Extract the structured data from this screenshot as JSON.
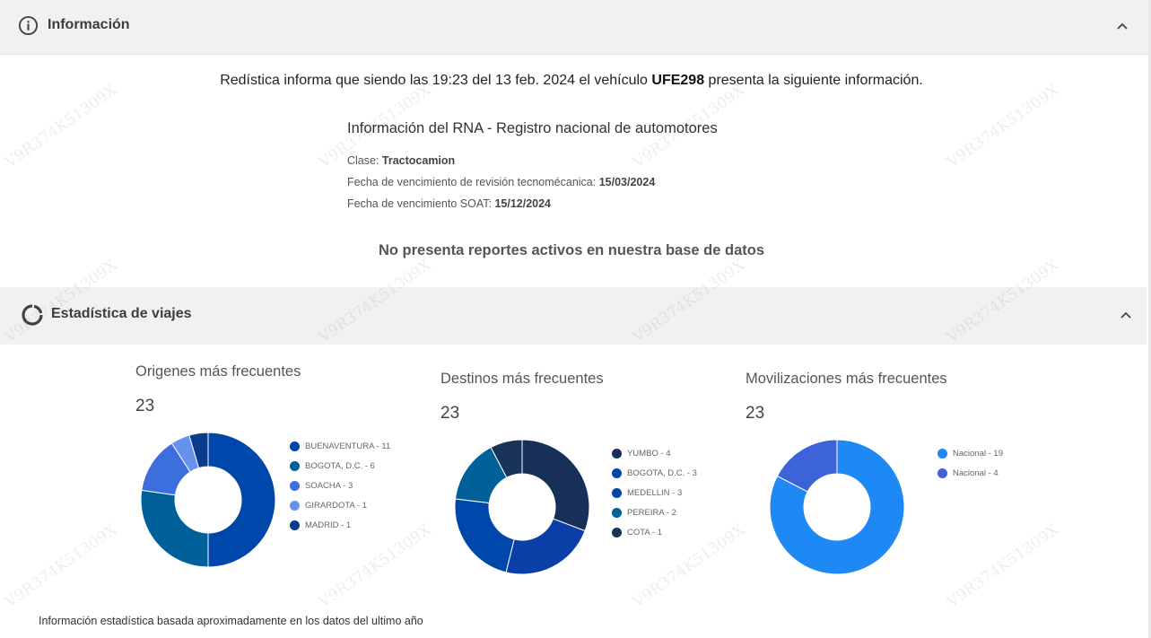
{
  "info": {
    "title": "Información",
    "intro_pre": "Redística informa que siendo las 19:23 del 13 feb. 2024 el vehículo ",
    "plate": "UFE298",
    "intro_post": " presenta la siguiente información.",
    "rna_title": "Información del RNA - Registro nacional de automotores",
    "clase_label": "Clase: ",
    "clase_value": "Tractocamion",
    "tecno_label": "Fecha de vencimiento de revisión tecnomécanica: ",
    "tecno_value": "15/03/2024",
    "soat_label": "Fecha de vencimiento SOAT: ",
    "soat_value": "15/12/2024",
    "no_reports": "No presenta reportes activos en nuestra base de datos"
  },
  "stats": {
    "title": "Estadística de viajes",
    "footer": "Información estadística basada aproximadamente en los datos del ultimo año"
  },
  "watermark_text": "V9R374K51309X",
  "icons": {
    "info": "info-circle-icon",
    "stats": "donut-chart-icon",
    "collapse": "chevron-up-icon"
  },
  "chart_data": [
    {
      "type": "pie",
      "title": "Origenes más frecuentes",
      "total": "23",
      "categories": [
        "BUENAVENTURA - 11",
        "BOGOTA, D.C. - 6",
        "SOACHA - 3",
        "GIRARDOTA - 1",
        "MADRID - 1"
      ],
      "values": [
        11,
        6,
        3,
        1,
        1
      ],
      "colors": [
        "#0047ab",
        "#00609a",
        "#3d6ede",
        "#6692ee",
        "#0b3b8c"
      ],
      "legend": "right"
    },
    {
      "type": "pie",
      "title": "Destinos más frecuentes",
      "total": "23",
      "categories": [
        "YUMBO - 4",
        "BOGOTA, D.C. - 3",
        "MEDELLIN - 3",
        "PEREIRA - 2",
        "COTA - 1"
      ],
      "values": [
        4,
        3,
        3,
        2,
        1
      ],
      "colors": [
        "#17305a",
        "#0a3fa8",
        "#0047ab",
        "#00609a",
        "#1a3358"
      ],
      "legend": "right"
    },
    {
      "type": "pie",
      "title": "Movilizaciones más frecuentes",
      "total": "23",
      "categories": [
        "Nacional - 19",
        "Nacional - 4"
      ],
      "values": [
        19,
        4
      ],
      "colors": [
        "#1e88f5",
        "#3d63d8"
      ],
      "legend": "right"
    }
  ]
}
